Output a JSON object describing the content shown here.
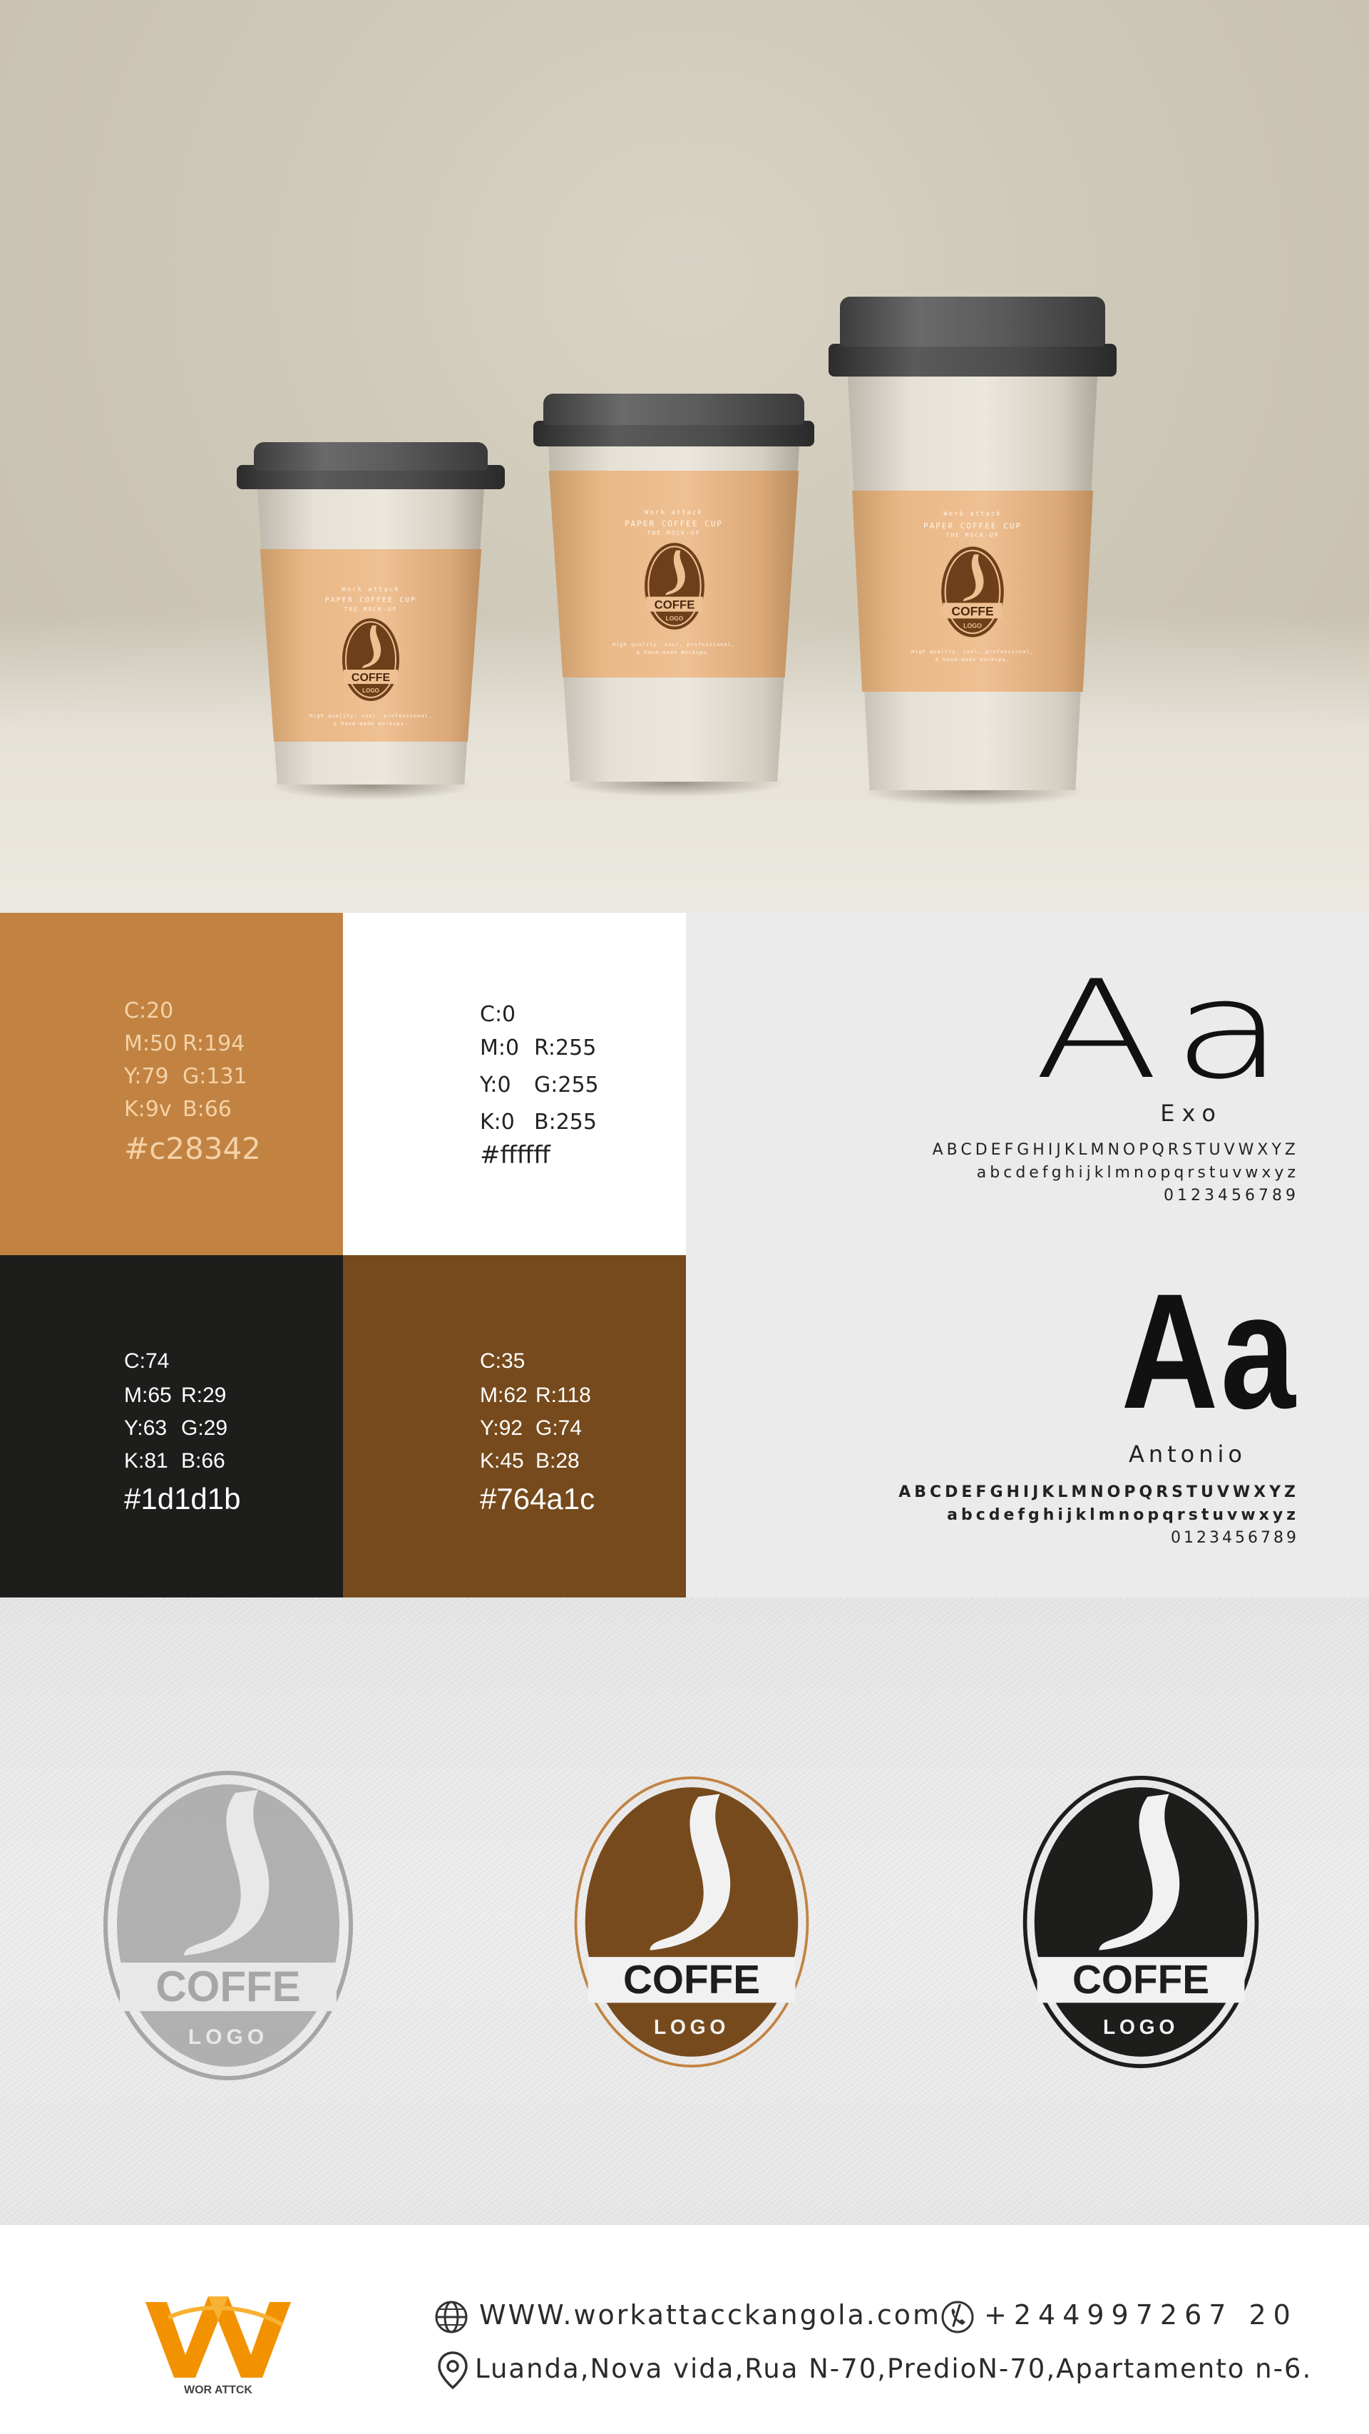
{
  "cups": {
    "brand_small": "Work attack",
    "product_title": "PAPER COFFEE CUP",
    "product_sub": "THE MOCK-UP",
    "tagline_1": "High quality, cool, professional,",
    "tagline_2": "& hand-made mockups.",
    "logo_word": "COFFE",
    "logo_sub": "LOGO"
  },
  "palette": [
    {
      "id": "orange",
      "color": "#c28342",
      "text_color": "#f4d2a8",
      "c": "C:20",
      "m": "M:50",
      "y": "Y:79",
      "k": "K:9v",
      "r": "R:194",
      "g": "G:131",
      "b": "B:66",
      "hex": "#c28342"
    },
    {
      "id": "white",
      "color": "#ffffff",
      "text_color": "#222222",
      "c": "C:0",
      "m": "M:0",
      "y": "Y:0",
      "k": "K:0",
      "r": "R:255",
      "g": "G:255",
      "b": "B:255",
      "hex": "#ffffff"
    },
    {
      "id": "black",
      "color": "#1d1d1b",
      "text_color": "#ffffff",
      "c": "C:74",
      "m": "M:65",
      "y": "Y:63",
      "k": "K:81",
      "r": "R:29",
      "g": "G:29",
      "b": "B:66",
      "hex": "#1d1d1b"
    },
    {
      "id": "brown",
      "color": "#764a1c",
      "text_color": "#ffffff",
      "c": "C:35",
      "m": "M:62",
      "y": "Y:92",
      "k": "K:45",
      "r": "R:118",
      "g": "G:74",
      "b": "B:28",
      "hex": "#764a1c"
    }
  ],
  "typography": [
    {
      "sample": "Aa",
      "name": "Exo",
      "upper": "ABCDEFGHIJKLMNOPQRSTUVWXYZ",
      "lower": "abcdefghijklmnopqrstuvwxyz",
      "digits": "0123456789"
    },
    {
      "sample": "Aa",
      "name": "Antonio",
      "upper": "ABCDEFGHIJKLMNOPQRSTUVWXYZ",
      "lower": "abcdefghijklmnopqrstuvwxyz",
      "digits": "0123456789"
    }
  ],
  "logos": {
    "word": "COFFE",
    "sub": "LOGO",
    "variants": [
      {
        "id": "grey",
        "fill": "#a6a6a6",
        "ring": "#8c8c8c",
        "text": "#a6a6a6"
      },
      {
        "id": "brown",
        "fill": "#764a1c",
        "ring": "#c28342",
        "text": "#1d1d1b"
      },
      {
        "id": "black",
        "fill": "#1d1d1b",
        "ring": "#1d1d1b",
        "text": "#1d1d1b"
      }
    ]
  },
  "footer": {
    "brand_logo_text": "WOR ATTCK",
    "website": "WWW.workattacckangola.com /",
    "phone": "+244997267 20",
    "address": "Luanda,Nova vida,Rua N-70,PredioN-70,Apartamento n-6.",
    "colors": {
      "brand_orange": "#f39200",
      "brand_orange_light": "#f7b233"
    },
    "icons": [
      "globe-icon",
      "phone-icon",
      "location-pin-icon"
    ]
  }
}
